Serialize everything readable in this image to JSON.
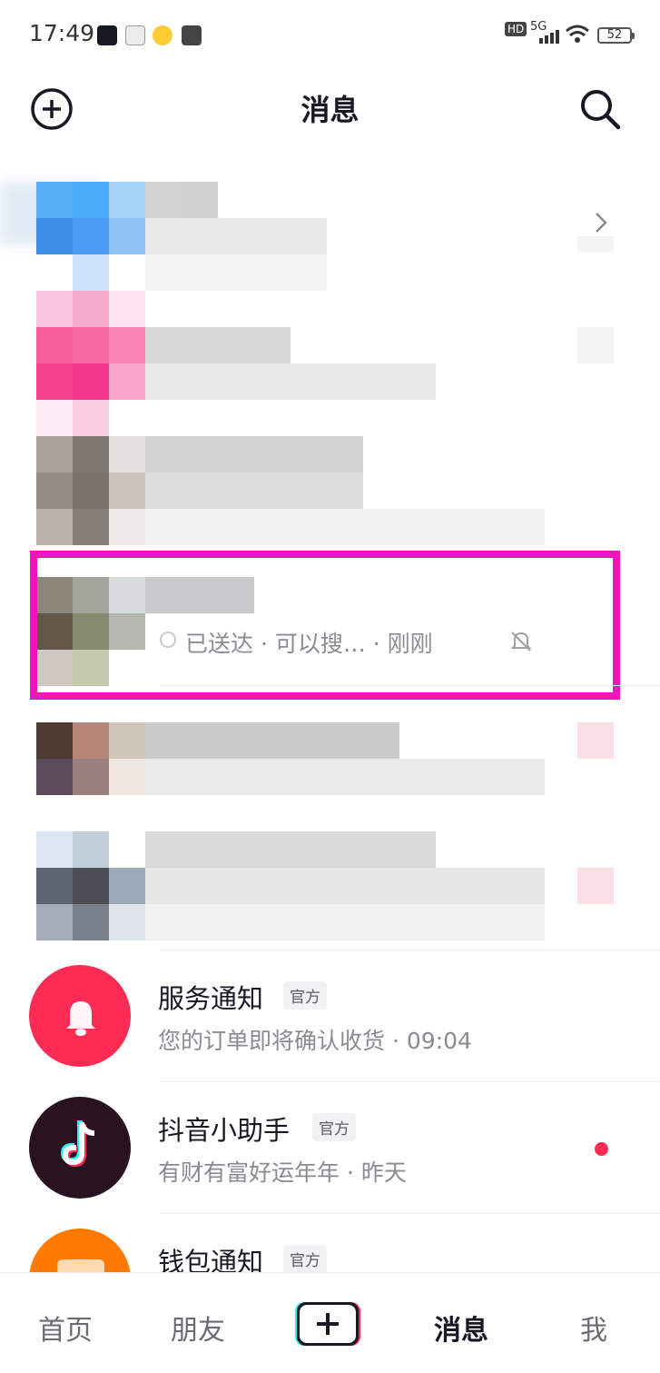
{
  "status_bar": {
    "time": "17:49",
    "app_icons": [
      "douyin-icon",
      "toutiao-icon",
      "weibo-icon",
      "message-app-icon"
    ],
    "indicators": [
      "HD",
      "5G"
    ],
    "battery": "52"
  },
  "header": {
    "title": "消息",
    "left_icon": "add-circle-icon",
    "right_icon": "search-icon"
  },
  "redacted_conversation": {
    "preview": "已送达 · 可以搜…  · 刚刚",
    "status_icon": "clock-icon",
    "mute_icon": "bell-off-icon"
  },
  "rows": [
    {
      "title": "服务通知",
      "badge": "官方",
      "subtitle": "您的订单即将确认收货 · 09:04",
      "icon": "bell-icon",
      "color": "#fe2c55"
    },
    {
      "title": "抖音小助手",
      "badge": "官方",
      "subtitle": "有财有富好运年年 · 昨天",
      "icon": "tiktok-note-icon",
      "color": "#161823",
      "unread": true
    },
    {
      "title": "钱包通知",
      "badge": "官方",
      "icon": "wallet-icon",
      "color": "#ff7a00"
    }
  ],
  "bottom_nav": {
    "items": [
      "首页",
      "朋友",
      "消息",
      "我"
    ],
    "active": "消息",
    "add_icon": "plus-icon"
  }
}
